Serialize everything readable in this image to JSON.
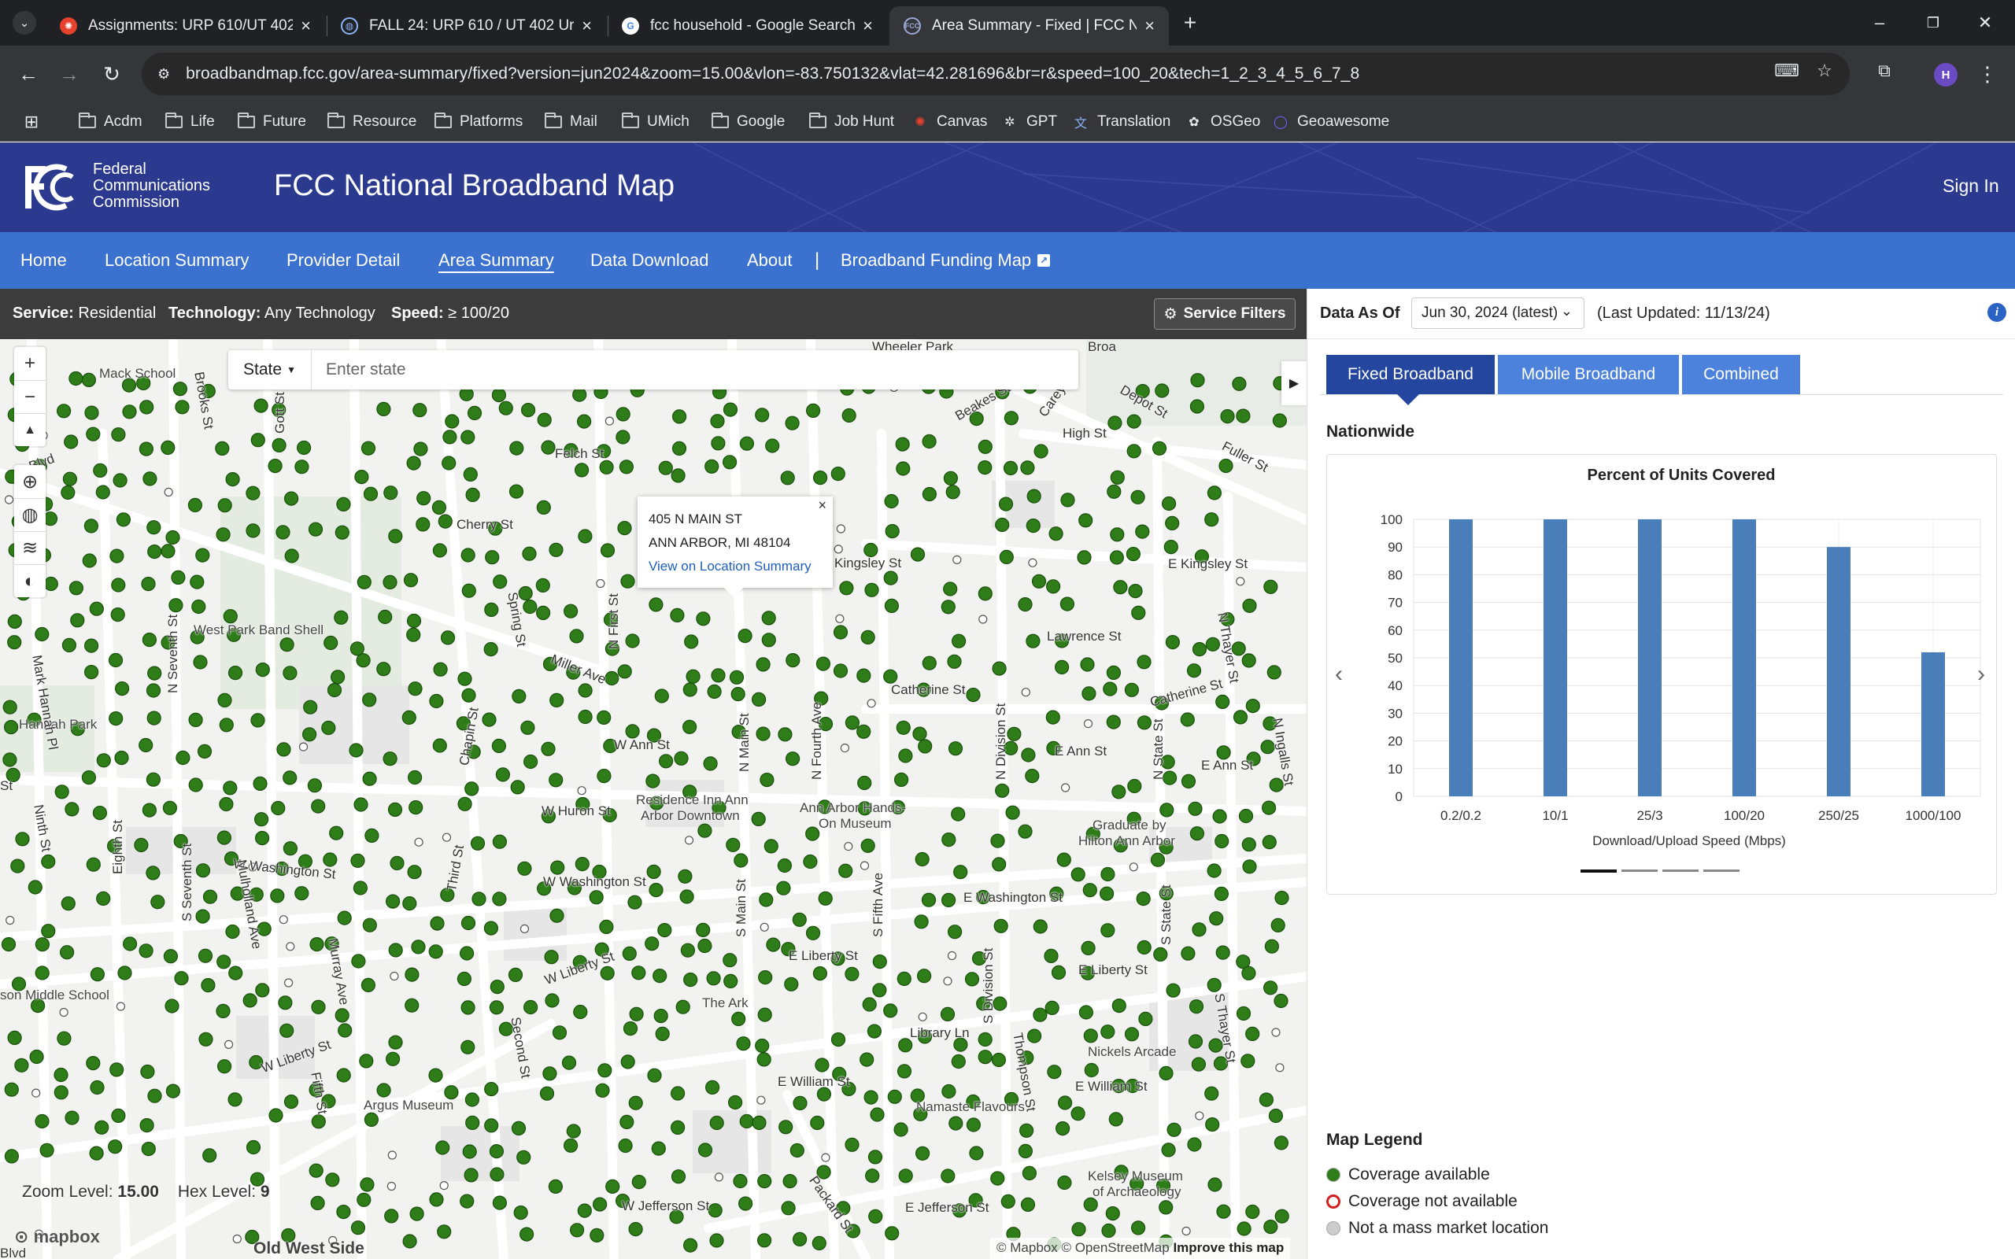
{
  "browser": {
    "tabs": [
      {
        "title": "Assignments: URP 610/UT 402 (",
        "icon": "canvas-icon"
      },
      {
        "title": "FALL 24: URP 610 / UT 402 Urba",
        "icon": "globe-icon"
      },
      {
        "title": "fcc household - Google Search",
        "icon": "google-icon"
      },
      {
        "title": "Area Summary - Fixed | FCC Nat",
        "icon": "fcc-icon"
      }
    ],
    "url": "broadbandmap.fcc.gov/area-summary/fixed?version=jun2024&zoom=15.00&vlon=-83.750132&vlat=42.281696&br=r&speed=100_20&tech=1_2_3_4_5_6_7_8",
    "profile_initial": "H",
    "bookmarks": [
      {
        "label": "Acdm",
        "icon": "folder-icon"
      },
      {
        "label": "Life",
        "icon": "folder-icon"
      },
      {
        "label": "Future",
        "icon": "folder-icon"
      },
      {
        "label": "Resource",
        "icon": "folder-icon"
      },
      {
        "label": "Platforms",
        "icon": "folder-icon"
      },
      {
        "label": "Mail",
        "icon": "folder-icon"
      },
      {
        "label": "UMich",
        "icon": "folder-icon"
      },
      {
        "label": "Google",
        "icon": "folder-icon"
      },
      {
        "label": "Job Hunt",
        "icon": "folder-icon"
      },
      {
        "label": "Canvas",
        "icon": "canvas-icon"
      },
      {
        "label": "GPT",
        "icon": "openai-icon"
      },
      {
        "label": "Translation",
        "icon": "translate-icon"
      },
      {
        "label": "OSGeo",
        "icon": "osgeo-icon"
      },
      {
        "label": "Geoawesome",
        "icon": "geoawesome-icon"
      }
    ]
  },
  "header": {
    "agency_line1": "Federal",
    "agency_line2": "Communications",
    "agency_line3": "Commission",
    "title": "FCC National Broadband Map",
    "sign_in": "Sign In",
    "colors": {
      "header_bg": "#2b3a8f",
      "nav_bg": "#3b71cf"
    }
  },
  "nav": {
    "items": [
      {
        "label": "Home"
      },
      {
        "label": "Location Summary"
      },
      {
        "label": "Provider Detail"
      },
      {
        "label": "Area Summary",
        "active": true
      },
      {
        "label": "Data Download"
      },
      {
        "label": "About"
      }
    ],
    "separator": "|",
    "funding_map": "Broadband Funding Map"
  },
  "filters": {
    "service_label": "Service:",
    "service_value": "Residential",
    "technology_label": "Technology:",
    "technology_value": "Any Technology",
    "speed_label": "Speed:",
    "speed_value": "≥ 100/20",
    "service_filters_button": "Service Filters"
  },
  "map": {
    "state_dropdown": "State",
    "state_placeholder": "Enter state",
    "popup": {
      "line1": "405 N MAIN ST",
      "line2": "ANN ARBOR, MI 48104",
      "link": "View on Location Summary",
      "close": "×"
    },
    "zoom_label": "Zoom Level:",
    "zoom_value": "15.00",
    "hex_label": "Hex Level:",
    "hex_value": "9",
    "mapbox": "mapbox",
    "attribution": "© Mapbox © OpenStreetMap",
    "improve": "Improve this map",
    "labels": {
      "mack_school": "Mack School",
      "wheeler_park": "Wheeler Park",
      "broadway": "Broa",
      "felch": "Felch St",
      "beakes": "Beakes St",
      "carey": "Carey St",
      "depot": "Depot St",
      "high": "High St",
      "fuller": "Fuller St",
      "cherry": "Cherry St",
      "spring": "Spring St",
      "kingsley": "Kingsley St",
      "e_kingsley": "E Kingsley St",
      "west_park_band_shell": "West Park Band Shell",
      "miller": "Miller Ave",
      "lawrence": "Lawrence St",
      "catherine": "Catherine St",
      "catherine2": "Catherine St",
      "hannah_park": "Hannah Park",
      "w_ann": "W Ann St",
      "e_ann": "E Ann St",
      "e_ann2": "E Ann St",
      "w_huron": "W Huron St",
      "residence_inn_1": "Residence Inn Ann",
      "residence_inn_2": "Arbor Downtown",
      "aa_hands_on_1": "Ann Arbor Hands-",
      "aa_hands_on_2": "On Museum",
      "graduate_1": "Graduate by",
      "graduate_2": "Hilton Ann Arbor",
      "w_washington": "W Washington St",
      "w_washington2": "W Washington St",
      "e_washington": "E Washington St",
      "e_liberty": "E Liberty St",
      "e_liberty2": "E Liberty St",
      "w_liberty": "W Liberty St",
      "w_liberty2": "W Liberty St",
      "the_ark": "The Ark",
      "library_ln": "Library Ln",
      "middle_school": "son Middle School",
      "argus": "Argus Museum",
      "e_william": "E William St",
      "e_william2": "E William St",
      "nickels": "Nickels Arcade",
      "namaste": "Namaste Flavours",
      "kelsey_1": "Kelsey Museum",
      "kelsey_2": "of Archaeology",
      "w_jefferson": "W Jefferson St",
      "e_jefferson": "E Jefferson St",
      "old_west_side": "Old West Side",
      "n_seventh": "N Seventh St",
      "s_seventh": "S Seventh St",
      "eighth": "Eighth St",
      "mark_hannah": "Mark Hannah Pl",
      "n_main": "N Main St",
      "s_main": "S Main St",
      "n_fourth": "N Fourth Ave",
      "n_division": "N Division St",
      "s_division": "S Division St",
      "n_state": "N State St",
      "s_state": "S State St",
      "s_thayer": "S Thayer St",
      "n_thayer": "N Thayer St",
      "s_fifth": "S Fifth Ave",
      "first": "N First St",
      "chapin": "Chapin St",
      "third": "Third St",
      "mulholland": "Mulholland Ave",
      "murray": "Murray Ave",
      "second": "Second St",
      "fifth_st": "Fifth St",
      "thompson": "Thompson St",
      "packard": "Packard St",
      "ingalls": "N Ingalls St",
      "brooks": "Brooks St",
      "gott": "Gott St",
      "w_blvd": "w Blvd",
      "w_blvd2": "Blvd",
      "ninth": "Ninth St",
      "st": "St"
    },
    "colors": {
      "coverage": "#2e7d18",
      "dot_outline": "#1a4f0c",
      "road": "#ffffff",
      "land": "#f2f2f0"
    }
  },
  "panel": {
    "data_as_of_label": "Data As Of",
    "date_value": "Jun 30, 2024 (latest)",
    "last_updated": "(Last Updated: 11/13/24)",
    "tabs": [
      {
        "label": "Fixed Broadband",
        "active": true
      },
      {
        "label": "Mobile Broadband"
      },
      {
        "label": "Combined"
      }
    ],
    "region": "Nationwide",
    "legend_title": "Map Legend",
    "legend": [
      {
        "label": "Coverage available",
        "color": "#2e7d18",
        "style": "filled"
      },
      {
        "label": "Coverage not available",
        "color": "#d21f1f",
        "style": "ring"
      },
      {
        "label": "Not a mass market location",
        "color": "#cccccc",
        "style": "filled"
      }
    ],
    "carousel": {
      "pages": 4,
      "active_page": 1
    }
  },
  "chart_data": {
    "type": "bar",
    "title": "Percent of Units Covered",
    "xlabel": "Download/Upload Speed (Mbps)",
    "ylabel": "",
    "categories": [
      "0.2/0.2",
      "10/1",
      "25/3",
      "100/20",
      "250/25",
      "1000/100"
    ],
    "values": [
      100,
      100,
      100,
      100,
      90,
      52
    ],
    "ylim": [
      0,
      100
    ],
    "yticks": [
      0,
      10,
      20,
      30,
      40,
      50,
      60,
      70,
      80,
      90,
      100
    ],
    "grid": true,
    "bar_color": "#4a7ebb"
  }
}
